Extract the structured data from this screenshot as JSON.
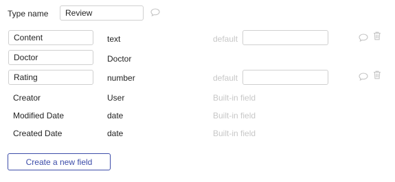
{
  "header": {
    "type_name_label": "Type name",
    "type_name_value": "Review"
  },
  "fields": [
    {
      "name": "Content",
      "type": "text",
      "has_default": true,
      "default_label": "default",
      "default_value": ""
    },
    {
      "name": "Doctor",
      "type": "Doctor",
      "has_default": false
    },
    {
      "name": "Rating",
      "type": "number",
      "has_default": true,
      "default_label": "default",
      "default_value": ""
    }
  ],
  "builtin_fields": [
    {
      "name": "Creator",
      "type": "User",
      "note": "Built-in field"
    },
    {
      "name": "Modified Date",
      "type": "date",
      "note": "Built-in field"
    },
    {
      "name": "Created Date",
      "type": "date",
      "note": "Built-in field"
    }
  ],
  "actions": {
    "create_label": "Create a new field"
  },
  "icons": {
    "comment": "comment-bubble-icon",
    "delete": "trash-icon"
  },
  "colors": {
    "accent": "#3b4ba8",
    "muted": "#c7c7c7",
    "icon": "#c4c4c4"
  }
}
